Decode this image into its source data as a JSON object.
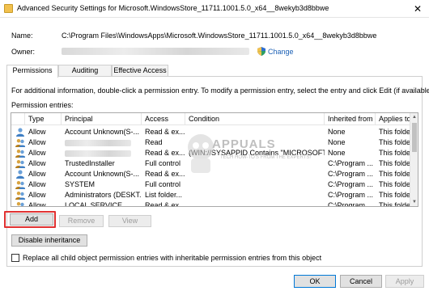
{
  "window": {
    "title": "Advanced Security Settings for Microsoft.WindowsStore_11711.1001.5.0_x64__8wekyb3d8bbwe",
    "close_glyph": "✕"
  },
  "fields": {
    "name_label": "Name:",
    "name_value": "C:\\Program Files\\WindowsApps\\Microsoft.WindowsStore_11711.1001.5.0_x64__8wekyb3d8bbwe",
    "owner_label": "Owner:",
    "change_link": "Change"
  },
  "tabs": [
    {
      "label": "Permissions",
      "active": true
    },
    {
      "label": "Auditing",
      "active": false
    },
    {
      "label": "Effective Access",
      "active": false
    }
  ],
  "info_text": "For additional information, double-click a permission entry. To modify a permission entry, select the entry and click Edit (if available).",
  "entries_label": "Permission entries:",
  "columns": [
    "Type",
    "Principal",
    "Access",
    "Condition",
    "Inherited from",
    "Applies to"
  ],
  "rows": [
    {
      "icon": "user-icon",
      "type": "Allow",
      "principal": "Account Unknown(S-...",
      "access": "Read & ex...",
      "condition": "",
      "inherited": "None",
      "applies": "This folder..."
    },
    {
      "icon": "group-icon",
      "type": "Allow",
      "principal": "",
      "access": "Read",
      "condition": "",
      "inherited": "None",
      "applies": "This folder..."
    },
    {
      "icon": "group-icon",
      "type": "Allow",
      "principal": "",
      "access": "Read & ex...",
      "condition": "(WIN://SYSAPPID Contains \"MICROSOFT....",
      "inherited": "None",
      "applies": "This folder..."
    },
    {
      "icon": "group-icon",
      "type": "Allow",
      "principal": "TrustedInstaller",
      "access": "Full control",
      "condition": "",
      "inherited": "C:\\Program ...",
      "applies": "This folder..."
    },
    {
      "icon": "user-icon",
      "type": "Allow",
      "principal": "Account Unknown(S-...",
      "access": "Read & ex...",
      "condition": "",
      "inherited": "C:\\Program ...",
      "applies": "This folder..."
    },
    {
      "icon": "group-icon",
      "type": "Allow",
      "principal": "SYSTEM",
      "access": "Full control",
      "condition": "",
      "inherited": "C:\\Program ...",
      "applies": "This folder..."
    },
    {
      "icon": "group-icon",
      "type": "Allow",
      "principal": "Administrators (DESKT...",
      "access": "List folder...",
      "condition": "",
      "inherited": "C:\\Program ...",
      "applies": "This folder..."
    },
    {
      "icon": "group-icon",
      "type": "Allow",
      "principal": "LOCAL SERVICE",
      "access": "Read & ex...",
      "condition": "",
      "inherited": "C:\\Program ...",
      "applies": "This folder..."
    }
  ],
  "buttons": {
    "add": "Add",
    "remove": "Remove",
    "view": "View",
    "disable_inheritance": "Disable inheritance",
    "ok": "OK",
    "cancel": "Cancel",
    "apply": "Apply"
  },
  "replace_checkbox": {
    "label": "Replace all child object permission entries with inheritable permission entries from this object",
    "checked": false
  },
  "watermark": {
    "main": "APPUALS",
    "sub": "TECH HOW-TO'S FROM THE EXPERTS!"
  },
  "colors": {
    "highlight": "#e03131",
    "link": "#1a5fb4"
  }
}
